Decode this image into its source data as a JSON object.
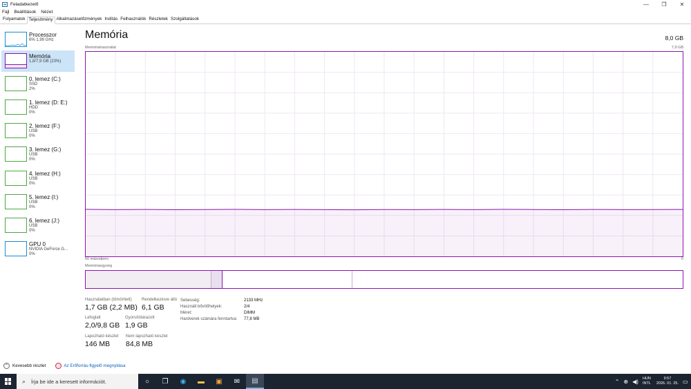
{
  "window": {
    "title": "Feladatkezelő",
    "minimize": "—",
    "maximize": "❐",
    "close": "✕"
  },
  "menu": [
    "Fájl",
    "Beállítások",
    "Nézet"
  ],
  "tabs": [
    "Folyamatok",
    "Teljesítmény",
    "Alkalmazáselőzmények",
    "Indítás",
    "Felhasználók",
    "Részletek",
    "Szolgáltatások"
  ],
  "active_tab": "Teljesítmény",
  "sidebar": {
    "items": [
      {
        "name": "Processzor",
        "sub1": "6% 1,99 GHz",
        "sub2": "",
        "kind": "cpu"
      },
      {
        "name": "Memória",
        "sub1": "1,8/7,9 GB (23%)",
        "sub2": "",
        "kind": "mem",
        "usage": 0.23
      },
      {
        "name": "0. lemez (C:)",
        "sub1": "SSD",
        "sub2": "2%",
        "kind": "disk"
      },
      {
        "name": "1. lemez (D: E:)",
        "sub1": "HDD",
        "sub2": "0%",
        "kind": "disk"
      },
      {
        "name": "2. lemez (F:)",
        "sub1": "USB",
        "sub2": "0%",
        "kind": "disk"
      },
      {
        "name": "3. lemez (G:)",
        "sub1": "USB",
        "sub2": "0%",
        "kind": "disk"
      },
      {
        "name": "4. lemez (H:)",
        "sub1": "USB",
        "sub2": "0%",
        "kind": "disk"
      },
      {
        "name": "5. lemez (I:)",
        "sub1": "USB",
        "sub2": "0%",
        "kind": "disk"
      },
      {
        "name": "6. lemez (J:)",
        "sub1": "USB",
        "sub2": "0%",
        "kind": "disk"
      },
      {
        "name": "GPU 0",
        "sub1": "NVIDIA GeForce G...",
        "sub2": "0%",
        "kind": "gpu"
      }
    ]
  },
  "main": {
    "title": "Memória",
    "total": "8,0 GB",
    "graph_label": "Memóriahasználat",
    "graph_max": "7,9 GB",
    "axis_left": "60 másodperc",
    "axis_right": "0",
    "composition_label": "Memóriaegység",
    "usage_fraction": 0.23
  },
  "stats": {
    "in_use": {
      "label": "Használatban (tömörített)",
      "value": "1,7 GB (2,2 MB)"
    },
    "available": {
      "label": "Rendelkezésre álló",
      "value": "6,1 GB"
    },
    "committed": {
      "label": "Lefoglalt",
      "value": "2,0/9,8 GB"
    },
    "cached": {
      "label": "Gyorsítótárazott",
      "value": "1,9 GB"
    },
    "paged_pool": {
      "label": "Lapozható készlet",
      "value": "146 MB"
    },
    "nonpaged_pool": {
      "label": "Nem lapozható készlet",
      "value": "84,8 MB"
    }
  },
  "details": [
    {
      "label": "Sebesség:",
      "value": "2133 MHz"
    },
    {
      "label": "Használt bővítőhelyek:",
      "value": "2/4"
    },
    {
      "label": "Méret:",
      "value": "DIMM"
    },
    {
      "label": "Hardverek számára fenntartva:",
      "value": "77,8 MB"
    }
  ],
  "footer": {
    "fewer_details": "Kevesebb részlet",
    "resource_monitor": "Az Erőforrás-figyelő megnyitása"
  },
  "taskbar": {
    "search_placeholder": "Írja be ide a keresett információt.",
    "lang1": "HUN",
    "lang2": "INTL",
    "time": "9:57",
    "date": "2026. 01. 25."
  },
  "colors": {
    "memory": "#8b12ae",
    "disk": "#4ba83f",
    "cpu": "#1a8bd1",
    "taskbar": "#1b2431"
  }
}
